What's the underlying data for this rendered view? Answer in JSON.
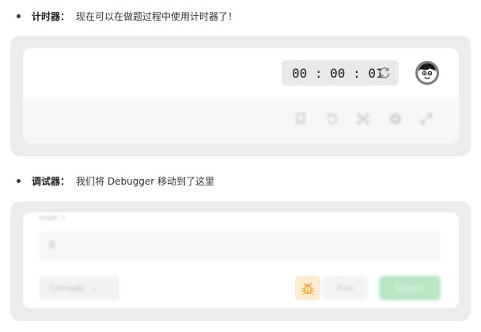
{
  "timer_section": {
    "title": "计时器：",
    "description": "现在可以在做题过程中使用计时器了！",
    "timer_value": "00 : 00 : 01"
  },
  "debugger_section": {
    "title": "调试器：",
    "description": "我们将 Debugger 移动到了这里",
    "target_label": "target =",
    "input_value": "9",
    "console_label": "Console",
    "console_caret": "⌄",
    "run_label": "Run",
    "submit_label": "Submit"
  },
  "colors": {
    "panel_bg": "#ececec",
    "submit_green": "#b9e6c5",
    "bug_orange": "#f0a32b"
  },
  "icons": [
    "reset-icon",
    "avatar",
    "bookmark-icon",
    "undo-icon",
    "shuffle-icon",
    "settings-icon",
    "expand-icon",
    "bug-icon"
  ]
}
